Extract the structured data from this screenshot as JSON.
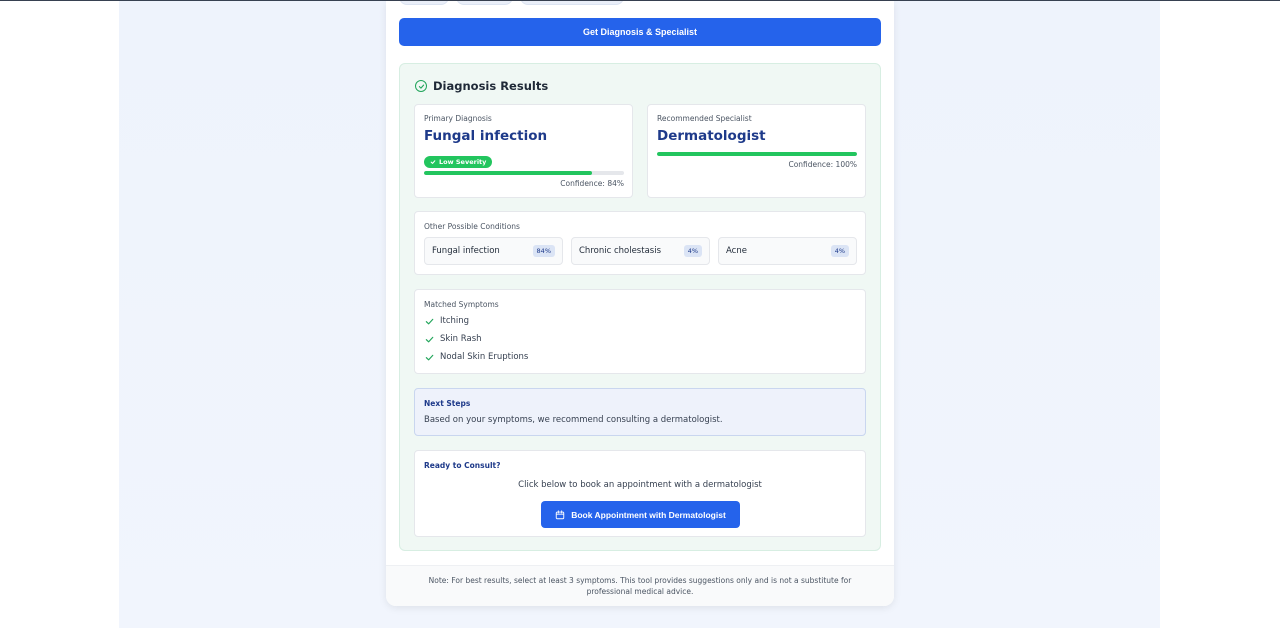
{
  "actions": {
    "get_diagnosis_label": "Get Diagnosis & Specialist"
  },
  "results": {
    "title": "Diagnosis Results",
    "primary": {
      "label": "Primary Diagnosis",
      "value": "Fungal infection",
      "severity": "Low Severity",
      "confidence_text": "Confidence: 84%",
      "confidence": 84
    },
    "specialist": {
      "label": "Recommended Specialist",
      "value": "Dermatologist",
      "confidence_text": "Confidence: 100%",
      "confidence": 100
    },
    "other": {
      "label": "Other Possible Conditions",
      "items": [
        {
          "name": "Fungal infection",
          "pct": "84%"
        },
        {
          "name": "Chronic cholestasis",
          "pct": "4%"
        },
        {
          "name": "Acne",
          "pct": "4%"
        }
      ]
    },
    "symptoms": {
      "label": "Matched Symptoms",
      "items": [
        "Itching",
        "Skin Rash",
        "Nodal Skin Eruptions"
      ]
    },
    "next_steps": {
      "title": "Next Steps",
      "text": "Based on your symptoms, we recommend consulting a dermatologist."
    },
    "consult": {
      "title": "Ready to Consult?",
      "text": "Click below to book an appointment with a dermatologist",
      "button_label": "Book Appointment with Dermatologist"
    }
  },
  "note": "Note: For best results, select at least 3 symptoms. This tool provides suggestions only and is not a substitute for professional medical advice.",
  "colors": {
    "primary": "#2563eb",
    "success": "#22c55e",
    "heading": "#1e3a8a"
  },
  "icons": [
    "check-circle-icon",
    "check-icon",
    "calendar-icon"
  ]
}
